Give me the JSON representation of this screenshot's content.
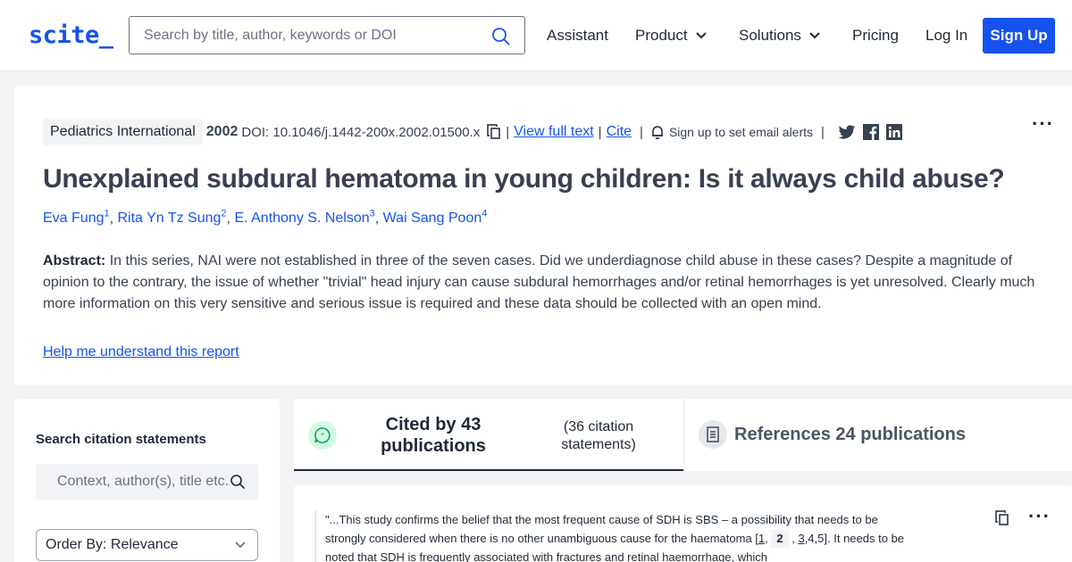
{
  "header": {
    "logo": "scite_",
    "search_placeholder": "Search by title, author, keywords or DOI",
    "nav": {
      "assistant": "Assistant",
      "product": "Product",
      "solutions": "Solutions",
      "pricing": "Pricing",
      "login": "Log In",
      "signup": "Sign Up"
    }
  },
  "paper": {
    "journal": "Pediatrics International",
    "year": "2002",
    "doi": "DOI: 10.1046/j.1442-200x.2002.01500.x",
    "view_full_text": "View full text",
    "cite": "Cite",
    "email_alert": "Sign up to set email alerts",
    "more": "···",
    "title": "Unexplained subdural hematoma in young children: Is it always child abuse?",
    "authors": [
      {
        "name": "Eva Fung",
        "sup": "1"
      },
      {
        "name": "Rita Yn Tz Sung",
        "sup": "2"
      },
      {
        "name": "E. Anthony S. Nelson",
        "sup": "3"
      },
      {
        "name": "Wai Sang Poon",
        "sup": "4"
      }
    ],
    "abstract_label": "Abstract:",
    "abstract_text": "In this series, NAI were not established in three of the seven cases. Did we underdiagnose child abuse in these cases? Despite a magnitude of opinion to the contrary, the issue of whether \"trivial\" head injury can cause subdural hemorrhages and/or retinal hemorrhages is yet unresolved. Clearly much more information on this very sensitive and serious issue is required and these data should be collected with an open mind.",
    "help_link": "Help me understand this report"
  },
  "sidebar": {
    "title": "Search citation statements",
    "search_placeholder": "Context, author(s), title etc.",
    "order_by": "Order By: Relevance"
  },
  "tabs": {
    "cited_main": "Cited by 43 publications",
    "cited_sub": "(36 citation statements)",
    "references": "References 24 publications"
  },
  "citation": {
    "text_before": "\"...This study confirms the belief that the most frequent cause of SDH is SBS – a possibility that needs to be strongly considered when there is no other unambiguous cause for the haematoma [",
    "ref1": "1",
    "ref_bold": "2",
    "ref3": "3",
    "refs_rest": ",4,5]. It",
    "text_after": "needs to be noted that SDH is frequently associated with fractures and retinal haemorrhage, which",
    "more": "···"
  },
  "colors": {
    "brand": "#1652f0",
    "cited_icon_bg": "#d1fae5",
    "cited_icon": "#16a34a"
  }
}
